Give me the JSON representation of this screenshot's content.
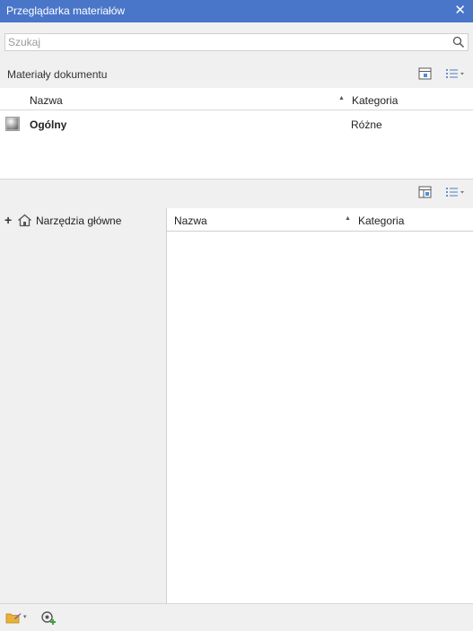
{
  "window": {
    "title": "Przeglądarka materiałów",
    "close_glyph": "✕"
  },
  "search": {
    "placeholder": "Szukaj",
    "value": "",
    "icon": "search-icon"
  },
  "document_materials": {
    "section_title": "Materiały dokumentu",
    "columns": {
      "name": "Nazwa",
      "category": "Kategoria",
      "sort_glyph": "▲"
    },
    "rows": [
      {
        "name": "Ogólny",
        "category": "Różne",
        "icon": "material-sphere-icon"
      }
    ]
  },
  "library": {
    "tree": [
      {
        "expander": "+",
        "label": "Narzędzia główne",
        "icon": "home-icon"
      }
    ],
    "columns": {
      "name": "Nazwa",
      "category": "Kategoria",
      "sort_glyph": "▲"
    },
    "rows": []
  },
  "bottom_toolbar": {
    "dropdown_glyph": "▾"
  },
  "colors": {
    "titlebar": "#4a76c9",
    "background": "#f0f0f0"
  }
}
